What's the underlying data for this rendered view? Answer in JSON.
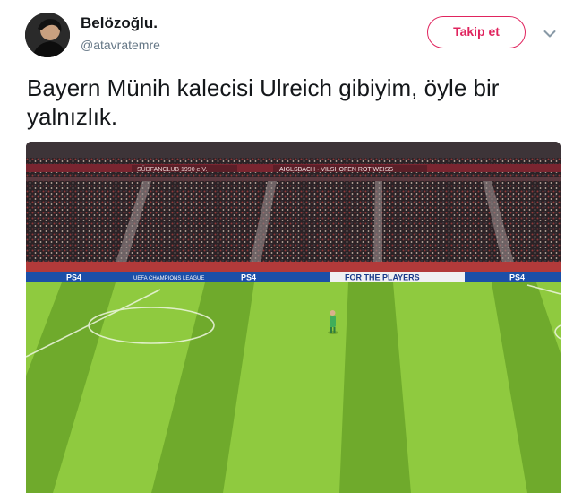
{
  "user": {
    "display_name": "Belözoğlu.",
    "handle": "@atavratemre",
    "avatar_icon": "user-avatar"
  },
  "actions": {
    "follow_label": "Takip et",
    "menu_icon": "chevron-down-icon"
  },
  "tweet": {
    "text_line1": "Bayern Münih kalecisi Ulreich gibiyim, öyle bir",
    "text_line2": "yalnızlık."
  },
  "photo": {
    "banner_fanclub": "SÜDFANCLUB 1990 e.V.",
    "banner_aiglsbach": "AIGLSBACH · VILSHOFEN ROT WEISS",
    "board_ps4": "PS4",
    "board_ucl": "UEFA CHAMPIONS LEAGUE",
    "board_players": "FOR THE PLAYERS"
  },
  "colors": {
    "follow": "#e0245e",
    "pitch_light": "#8fca3f",
    "pitch_dark": "#6faa2c"
  }
}
